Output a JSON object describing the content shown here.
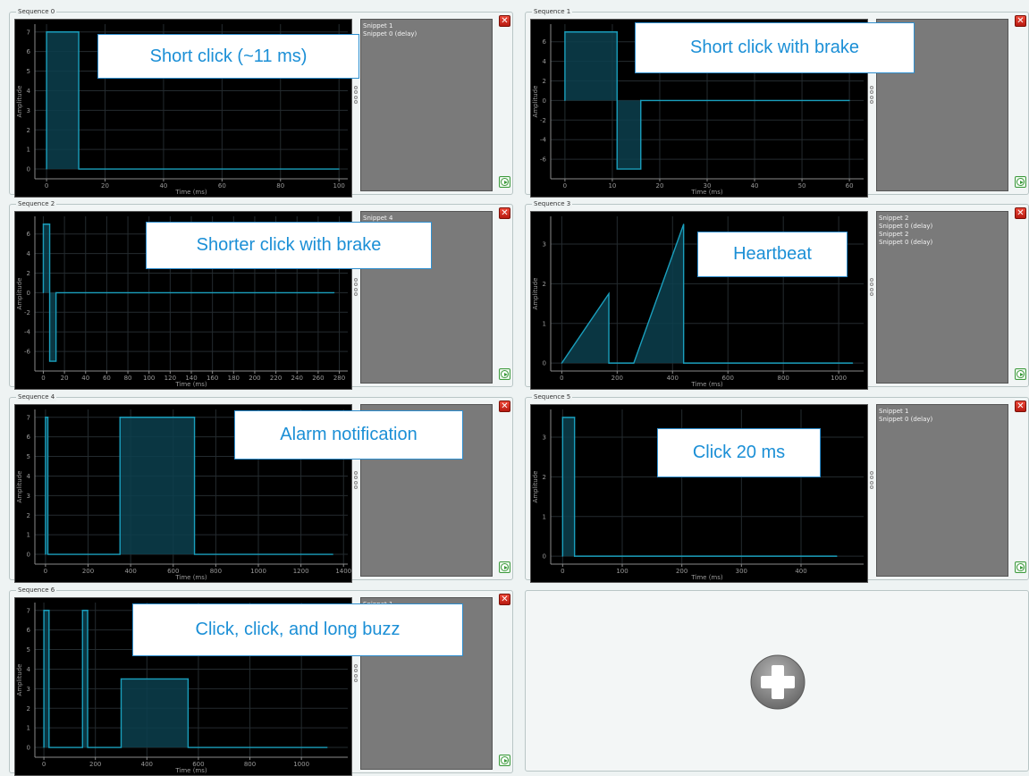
{
  "theme": {
    "trace": "#1a9fbd",
    "fill": "#0c3f4d",
    "grid": "#242b2f",
    "axis": "#8a8a8a",
    "text": "#9a9a9a"
  },
  "chart_labels": {
    "ylabel": "Amplitude",
    "xlabel": "Time (ms)"
  },
  "controls": {
    "delete_glyph": "✕",
    "delete_icon": "close-icon",
    "play_icon": "play-icon",
    "add_icon": "plus-circle-icon"
  },
  "sequences": [
    {
      "title": "Sequence 0",
      "callout": "Short click (~11 ms)",
      "snippets": [
        "Snippet 1",
        "Snippet 0 (delay)"
      ],
      "chart_data": {
        "type": "line",
        "xlabel": "Time (ms)",
        "ylabel": "Amplitude",
        "xlim": [
          -4,
          103
        ],
        "ylim": [
          -0.5,
          7.4
        ],
        "xticks": [
          0,
          20,
          40,
          60,
          80,
          100
        ],
        "yticks": [
          0,
          1,
          2,
          3,
          4,
          5,
          6,
          7
        ],
        "x": [
          0,
          0,
          11,
          11,
          100
        ],
        "y": [
          0,
          7,
          7,
          0,
          0
        ]
      }
    },
    {
      "title": "Sequence 1",
      "callout": "Short click with brake",
      "snippets": [
        "",
        "3",
        "0 (delay)"
      ],
      "chart_data": {
        "type": "line",
        "xlabel": "Time (ms)",
        "ylabel": "Amplitude",
        "xlim": [
          -3,
          63
        ],
        "ylim": [
          -8,
          7.8
        ],
        "xticks": [
          0,
          10,
          20,
          30,
          40,
          50,
          60
        ],
        "yticks": [
          -6,
          -4,
          -2,
          0,
          2,
          4,
          6
        ],
        "x": [
          0,
          0,
          11,
          11,
          16,
          16,
          60
        ],
        "y": [
          0,
          7,
          7,
          -7,
          -7,
          0,
          0
        ]
      }
    },
    {
      "title": "Sequence 2",
      "callout": "Shorter click with brake",
      "snippets": [
        "Snippet 4"
      ],
      "chart_data": {
        "type": "line",
        "xlabel": "Time (ms)",
        "ylabel": "Amplitude",
        "xlim": [
          -8,
          288
        ],
        "ylim": [
          -8,
          7.8
        ],
        "xticks": [
          0,
          20,
          40,
          60,
          80,
          100,
          120,
          140,
          160,
          180,
          200,
          220,
          240,
          260,
          280
        ],
        "yticks": [
          -6,
          -4,
          -2,
          0,
          2,
          4,
          6
        ],
        "x": [
          0,
          0,
          6,
          6,
          12,
          12,
          275
        ],
        "y": [
          0,
          7,
          7,
          -7,
          -7,
          0,
          0
        ]
      }
    },
    {
      "title": "Sequence 3",
      "callout": "Heartbeat",
      "snippets": [
        "Snippet 2",
        "Snippet 0 (delay)",
        "Snippet 2",
        "Snippet 0 (delay)"
      ],
      "chart_data": {
        "type": "line",
        "xlabel": "Time (ms)",
        "ylabel": "Amplitude",
        "xlim": [
          -40,
          1090
        ],
        "ylim": [
          -0.2,
          3.7
        ],
        "xticks": [
          0,
          200,
          400,
          600,
          800,
          1000
        ],
        "yticks": [
          0,
          1,
          2,
          3
        ],
        "x": [
          0,
          170,
          170,
          260,
          440,
          440,
          1050
        ],
        "y": [
          0,
          1.75,
          0,
          0,
          3.5,
          0,
          0
        ]
      }
    },
    {
      "title": "Sequence 4",
      "callout": "Alarm notification",
      "snippets": [],
      "chart_data": {
        "type": "line",
        "xlabel": "Time (ms)",
        "ylabel": "Amplitude",
        "xlim": [
          -50,
          1420
        ],
        "ylim": [
          -0.5,
          7.4
        ],
        "xticks": [
          0,
          200,
          400,
          600,
          800,
          1000,
          1200,
          1400
        ],
        "yticks": [
          0,
          1,
          2,
          3,
          4,
          5,
          6,
          7
        ],
        "x": [
          0,
          0,
          11,
          11,
          350,
          350,
          700,
          700,
          1350
        ],
        "y": [
          0,
          7,
          7,
          0,
          0,
          7,
          7,
          0,
          0
        ]
      }
    },
    {
      "title": "Sequence 5",
      "callout": "Click 20 ms",
      "snippets": [
        "Snippet 1",
        "Snippet 0 (delay)"
      ],
      "chart_data": {
        "type": "line",
        "xlabel": "Time (ms)",
        "ylabel": "Amplitude",
        "xlim": [
          -20,
          505
        ],
        "ylim": [
          -0.2,
          3.7
        ],
        "xticks": [
          0,
          100,
          200,
          300,
          400
        ],
        "yticks": [
          0,
          1,
          2,
          3
        ],
        "x": [
          0,
          0,
          20,
          20,
          460
        ],
        "y": [
          0,
          3.5,
          3.5,
          0,
          0
        ]
      }
    },
    {
      "title": "Sequence 6",
      "callout": "Click, click, and long buzz",
      "snippets": [
        "Snippet 1",
        "",
        "",
        "",
        "",
        "",
        "",
        "Snippet 0 (delay)"
      ],
      "chart_data": {
        "type": "line",
        "xlabel": "Time (ms)",
        "ylabel": "Amplitude",
        "xlim": [
          -35,
          1180
        ],
        "ylim": [
          -0.5,
          7.4
        ],
        "xticks": [
          0,
          200,
          400,
          600,
          800,
          1000
        ],
        "yticks": [
          0,
          1,
          2,
          3,
          4,
          5,
          6,
          7
        ],
        "x": [
          0,
          0,
          20,
          20,
          150,
          150,
          170,
          170,
          300,
          300,
          560,
          560,
          1100
        ],
        "y": [
          0,
          7,
          7,
          0,
          0,
          7,
          7,
          0,
          0,
          3.5,
          3.5,
          0,
          0
        ]
      }
    }
  ]
}
